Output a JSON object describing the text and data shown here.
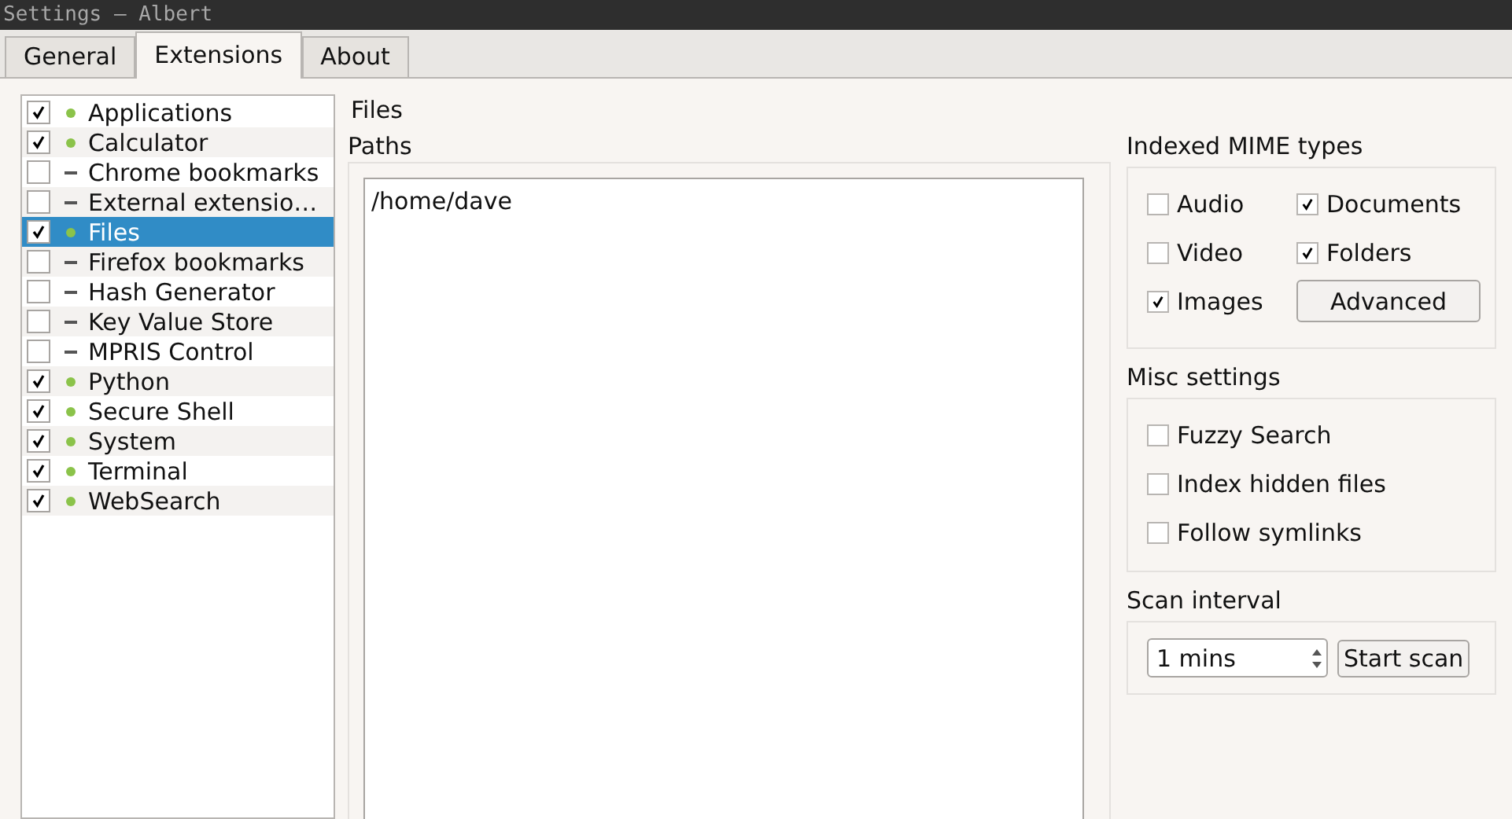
{
  "window": {
    "title": "Settings — Albert"
  },
  "tabs": [
    {
      "label": "General",
      "selected": false
    },
    {
      "label": "Extensions",
      "selected": true
    },
    {
      "label": "About",
      "selected": false
    }
  ],
  "extensions": [
    {
      "name": "Applications",
      "checked": true,
      "loaded": true,
      "selected": false
    },
    {
      "name": "Calculator",
      "checked": true,
      "loaded": true,
      "selected": false
    },
    {
      "name": "Chrome bookmarks",
      "checked": false,
      "loaded": false,
      "selected": false
    },
    {
      "name": "External extensio…",
      "checked": false,
      "loaded": false,
      "selected": false
    },
    {
      "name": "Files",
      "checked": true,
      "loaded": true,
      "selected": true
    },
    {
      "name": "Firefox bookmarks",
      "checked": false,
      "loaded": false,
      "selected": false
    },
    {
      "name": "Hash Generator",
      "checked": false,
      "loaded": false,
      "selected": false
    },
    {
      "name": "Key Value Store",
      "checked": false,
      "loaded": false,
      "selected": false
    },
    {
      "name": "MPRIS Control",
      "checked": false,
      "loaded": false,
      "selected": false
    },
    {
      "name": "Python",
      "checked": true,
      "loaded": true,
      "selected": false
    },
    {
      "name": "Secure Shell",
      "checked": true,
      "loaded": true,
      "selected": false
    },
    {
      "name": "System",
      "checked": true,
      "loaded": true,
      "selected": false
    },
    {
      "name": "Terminal",
      "checked": true,
      "loaded": true,
      "selected": false
    },
    {
      "name": "WebSearch",
      "checked": true,
      "loaded": true,
      "selected": false
    }
  ],
  "page_title": "Files",
  "paths": {
    "label": "Paths",
    "items": [
      "/home/dave"
    ]
  },
  "mime_types": {
    "title": "Indexed MIME types",
    "items": [
      {
        "label": "Audio",
        "checked": false
      },
      {
        "label": "Documents",
        "checked": true
      },
      {
        "label": "Video",
        "checked": false
      },
      {
        "label": "Folders",
        "checked": true
      },
      {
        "label": "Images",
        "checked": true
      }
    ],
    "advanced_button": "Advanced"
  },
  "misc": {
    "title": "Misc settings",
    "items": [
      {
        "label": "Fuzzy Search",
        "checked": false
      },
      {
        "label": "Index hidden files",
        "checked": false
      },
      {
        "label": "Follow symlinks",
        "checked": false
      }
    ]
  },
  "scan": {
    "title": "Scan interval",
    "value": "1 mins",
    "button": "Start scan"
  }
}
